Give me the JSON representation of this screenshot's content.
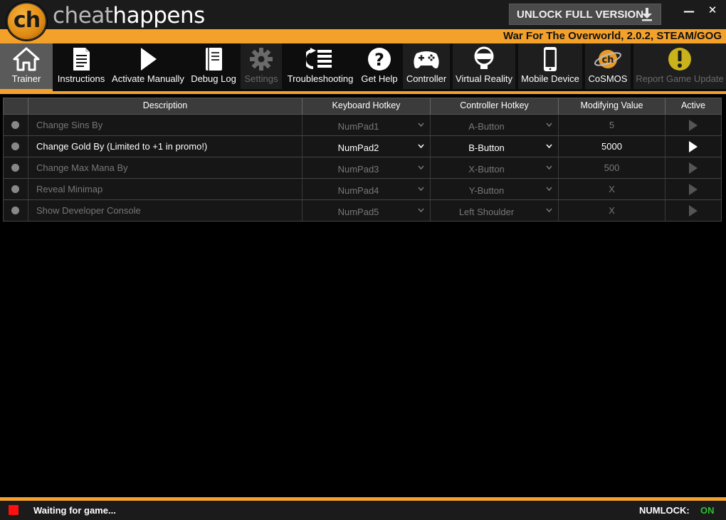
{
  "brand": {
    "logo_text": "ch",
    "word1": "cheat",
    "word2": "happens"
  },
  "header": {
    "unlock_label": "UNLOCK FULL VERSION",
    "minimize_glyph": "—",
    "close_glyph": "✕",
    "game_title": "War For The Overworld, 2.0.2, STEAM/GOG"
  },
  "toolbar": {
    "items": [
      {
        "label": "Trainer",
        "icon": "home-icon",
        "state": "active"
      },
      {
        "label": "Instructions",
        "icon": "document-icon",
        "state": "normal"
      },
      {
        "label": "Activate Manually",
        "icon": "play-icon",
        "state": "normal"
      },
      {
        "label": "Debug Log",
        "icon": "notebook-icon",
        "state": "normal"
      },
      {
        "label": "Settings",
        "icon": "gear-icon",
        "state": "disabled"
      },
      {
        "label": "Troubleshooting",
        "icon": "list-icon",
        "state": "normal"
      },
      {
        "label": "Get Help",
        "icon": "help-icon",
        "state": "normal"
      },
      {
        "label": "Controller",
        "icon": "gamepad-icon",
        "state": "dim"
      },
      {
        "label": "Virtual Reality",
        "icon": "vr-headset-icon",
        "state": "dim"
      },
      {
        "label": "Mobile Device",
        "icon": "phone-icon",
        "state": "dim"
      },
      {
        "label": "CoSMOS",
        "icon": "cosmos-icon",
        "state": "dim"
      },
      {
        "label": "Report Game Update",
        "icon": "warning-icon",
        "state": "dim-disabled"
      }
    ]
  },
  "table": {
    "headers": {
      "description": "Description",
      "keyboard": "Keyboard Hotkey",
      "controller": "Controller Hotkey",
      "value": "Modifying Value",
      "active": "Active"
    },
    "rows": [
      {
        "description": "Change Sins By",
        "keyboard": "NumPad1",
        "controller": "A-Button",
        "value": "5",
        "enabled": false
      },
      {
        "description": "Change Gold By (Limited to +1 in promo!)",
        "keyboard": "NumPad2",
        "controller": "B-Button",
        "value": "5000",
        "enabled": true
      },
      {
        "description": "Change Max Mana By",
        "keyboard": "NumPad3",
        "controller": "X-Button",
        "value": "500",
        "enabled": false
      },
      {
        "description": "Reveal Minimap",
        "keyboard": "NumPad4",
        "controller": "Y-Button",
        "value": "X",
        "enabled": false
      },
      {
        "description": "Show Developer Console",
        "keyboard": "NumPad5",
        "controller": "Left Shoulder",
        "value": "X",
        "enabled": false
      }
    ]
  },
  "status": {
    "indicator_color": "#ff1010",
    "message": "Waiting for game...",
    "numlock_label": "NUMLOCK:",
    "numlock_value": "ON"
  },
  "colors": {
    "accent": "#f4a12b",
    "numlock_on": "#2ec02e"
  }
}
